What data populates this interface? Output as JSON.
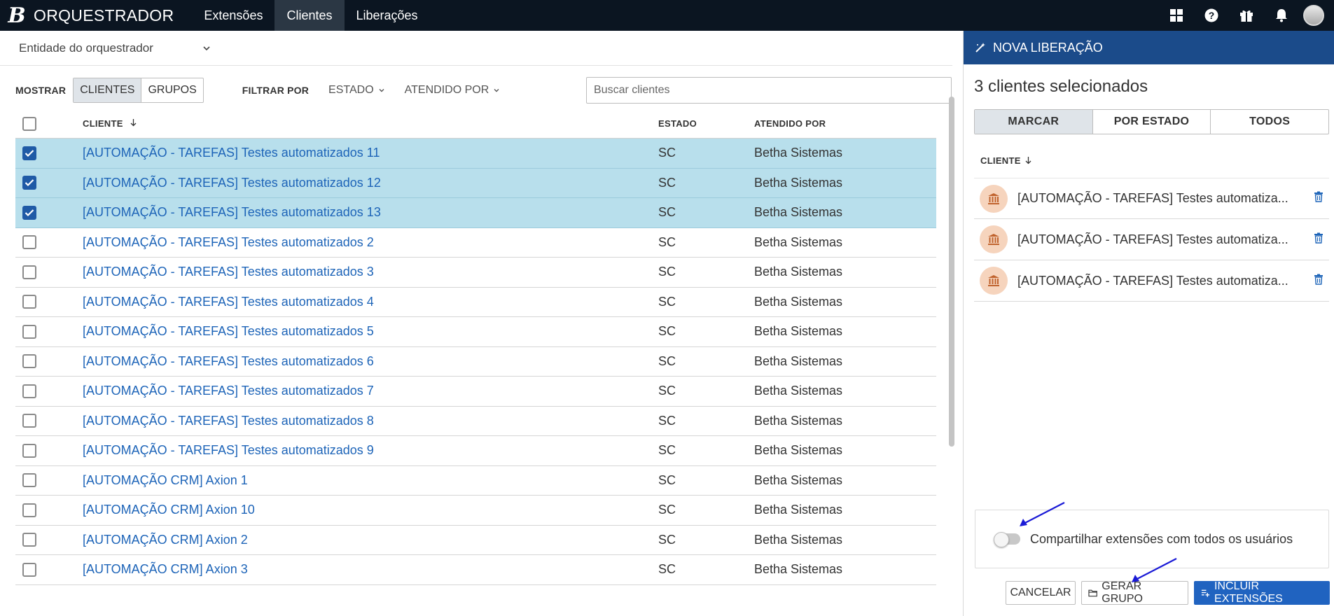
{
  "topbar": {
    "logo": "B",
    "app_title": "ORQUESTRADOR",
    "nav": [
      "Extensões",
      "Clientes",
      "Liberações"
    ],
    "active_nav": "Clientes",
    "icons": [
      "apps-grid-icon",
      "help-icon",
      "gift-icon",
      "bell-icon",
      "avatar"
    ]
  },
  "main": {
    "entity_select": "Entidade do orquestrador",
    "show_label": "MOSTRAR",
    "show_options": [
      "CLIENTES",
      "GRUPOS"
    ],
    "show_selected": "CLIENTES",
    "filter_label": "FILTRAR POR",
    "filter_state": "ESTADO",
    "filter_attended": "ATENDIDO POR",
    "search_placeholder": "Buscar clientes",
    "columns": {
      "client": "CLIENTE",
      "state": "ESTADO",
      "attended": "ATENDIDO POR"
    },
    "rows": [
      {
        "client": "[AUTOMAÇÃO - TAREFAS] Testes automatizados 11",
        "state": "SC",
        "attended": "Betha Sistemas",
        "checked": true
      },
      {
        "client": "[AUTOMAÇÃO - TAREFAS] Testes automatizados 12",
        "state": "SC",
        "attended": "Betha Sistemas",
        "checked": true
      },
      {
        "client": "[AUTOMAÇÃO - TAREFAS] Testes automatizados 13",
        "state": "SC",
        "attended": "Betha Sistemas",
        "checked": true
      },
      {
        "client": "[AUTOMAÇÃO - TAREFAS] Testes automatizados 2",
        "state": "SC",
        "attended": "Betha Sistemas",
        "checked": false
      },
      {
        "client": "[AUTOMAÇÃO - TAREFAS] Testes automatizados 3",
        "state": "SC",
        "attended": "Betha Sistemas",
        "checked": false
      },
      {
        "client": "[AUTOMAÇÃO - TAREFAS] Testes automatizados 4",
        "state": "SC",
        "attended": "Betha Sistemas",
        "checked": false
      },
      {
        "client": "[AUTOMAÇÃO - TAREFAS] Testes automatizados 5",
        "state": "SC",
        "attended": "Betha Sistemas",
        "checked": false
      },
      {
        "client": "[AUTOMAÇÃO - TAREFAS] Testes automatizados 6",
        "state": "SC",
        "attended": "Betha Sistemas",
        "checked": false
      },
      {
        "client": "[AUTOMAÇÃO - TAREFAS] Testes automatizados 7",
        "state": "SC",
        "attended": "Betha Sistemas",
        "checked": false
      },
      {
        "client": "[AUTOMAÇÃO - TAREFAS] Testes automatizados 8",
        "state": "SC",
        "attended": "Betha Sistemas",
        "checked": false
      },
      {
        "client": "[AUTOMAÇÃO - TAREFAS] Testes automatizados 9",
        "state": "SC",
        "attended": "Betha Sistemas",
        "checked": false
      },
      {
        "client": "[AUTOMAÇÃO CRM] Axion 1",
        "state": "SC",
        "attended": "Betha Sistemas",
        "checked": false
      },
      {
        "client": "[AUTOMAÇÃO CRM] Axion 10",
        "state": "SC",
        "attended": "Betha Sistemas",
        "checked": false
      },
      {
        "client": "[AUTOMAÇÃO CRM] Axion 2",
        "state": "SC",
        "attended": "Betha Sistemas",
        "checked": false
      },
      {
        "client": "[AUTOMAÇÃO CRM] Axion 3",
        "state": "SC",
        "attended": "Betha Sistemas",
        "checked": false
      }
    ]
  },
  "panel": {
    "header": "NOVA LIBERAÇÃO",
    "selected_count": "3 clientes selecionados",
    "tabs": [
      "MARCAR",
      "POR ESTADO",
      "TODOS"
    ],
    "tab_selected": "MARCAR",
    "column": "CLIENTE",
    "items": [
      "[AUTOMAÇÃO - TAREFAS] Testes automatiza...",
      "[AUTOMAÇÃO - TAREFAS] Testes automatiza...",
      "[AUTOMAÇÃO - TAREFAS] Testes automatiza..."
    ],
    "share_label": "Compartilhar extensões com todos os usuários",
    "share_enabled": false,
    "buttons": {
      "cancel": "CANCELAR",
      "group": "GERAR GRUPO",
      "include": "INCLUIR EXTENSÕES"
    }
  },
  "colors": {
    "topbar": "#0b1521",
    "panel_header": "#1b4b8a",
    "selected_row": "#b8dfec",
    "link": "#1d64b8",
    "primary_button": "#2063c0",
    "annotation_arrow": "#1a1ad6"
  }
}
